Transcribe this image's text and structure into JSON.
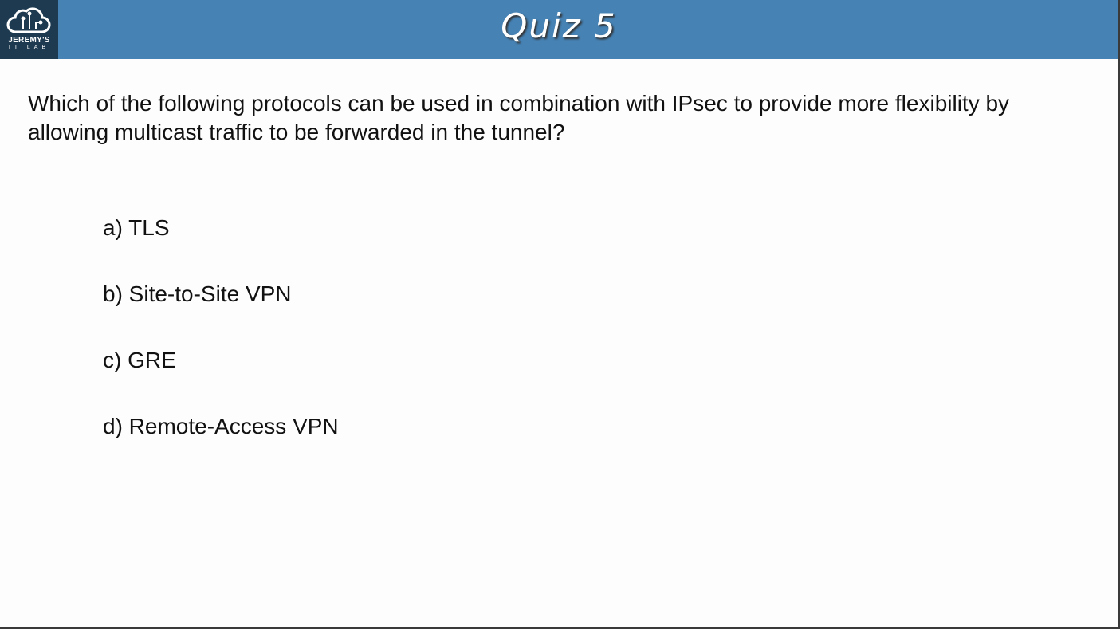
{
  "header": {
    "title": "Quiz 5",
    "logo_line1": "JEREMY'S",
    "logo_line2": "IT LAB"
  },
  "question": "Which of the following protocols can be used in combination with IPsec to provide more flexibility by allowing multicast traffic to be forwarded in the tunnel?",
  "options": [
    "a) TLS",
    "b) Site-to-Site VPN",
    "c) GRE",
    "d) Remote-Access VPN"
  ]
}
